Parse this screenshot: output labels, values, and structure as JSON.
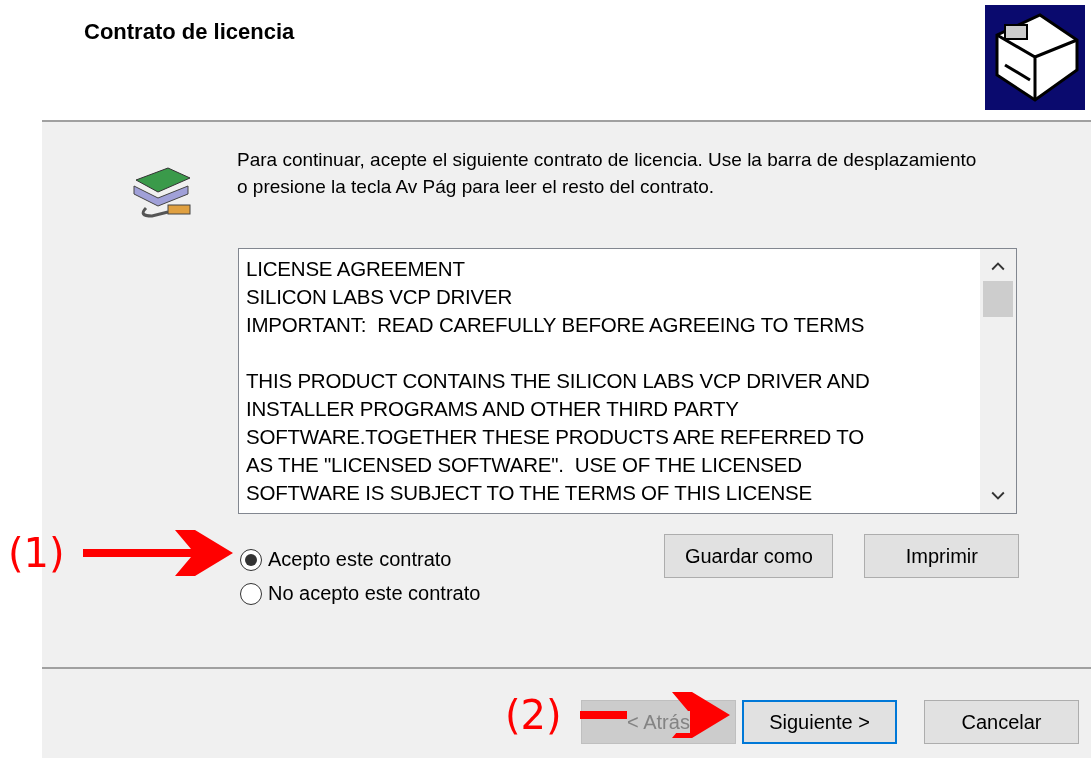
{
  "header": {
    "title": "Contrato de licencia"
  },
  "instructions": "Para continuar, acepte el siguiente contrato de licencia. Use la barra de desplazamiento o presione la tecla Av Pág para leer el resto del contrato.",
  "license_text": {
    "paragraphs": [
      [
        "LICENSE AGREEMENT",
        "SILICON LABS VCP DRIVER",
        "IMPORTANT:  READ CAREFULLY BEFORE AGREEING TO TERMS"
      ],
      [
        "THIS PRODUCT CONTAINS THE SILICON LABS VCP DRIVER AND",
        "INSTALLER PROGRAMS AND OTHER THIRD PARTY",
        "SOFTWARE.TOGETHER THESE PRODUCTS ARE REFERRED TO",
        "AS THE \"LICENSED SOFTWARE\".  USE OF THE LICENSED",
        "SOFTWARE IS SUBJECT TO THE TERMS OF THIS LICENSE"
      ]
    ]
  },
  "options": [
    {
      "label": "Acepto este contrato",
      "selected": true
    },
    {
      "label": "No acepto este contrato",
      "selected": false
    }
  ],
  "side_buttons": [
    "Guardar como",
    "Imprimir"
  ],
  "nav_buttons": [
    {
      "label": "< Atrás",
      "disabled": true,
      "focused": false
    },
    {
      "label": "Siguiente >",
      "disabled": false,
      "focused": true
    },
    {
      "label": "Cancelar",
      "disabled": false,
      "focused": false
    }
  ],
  "annotations": [
    {
      "label": "(1)"
    },
    {
      "label": "(2)"
    }
  ]
}
